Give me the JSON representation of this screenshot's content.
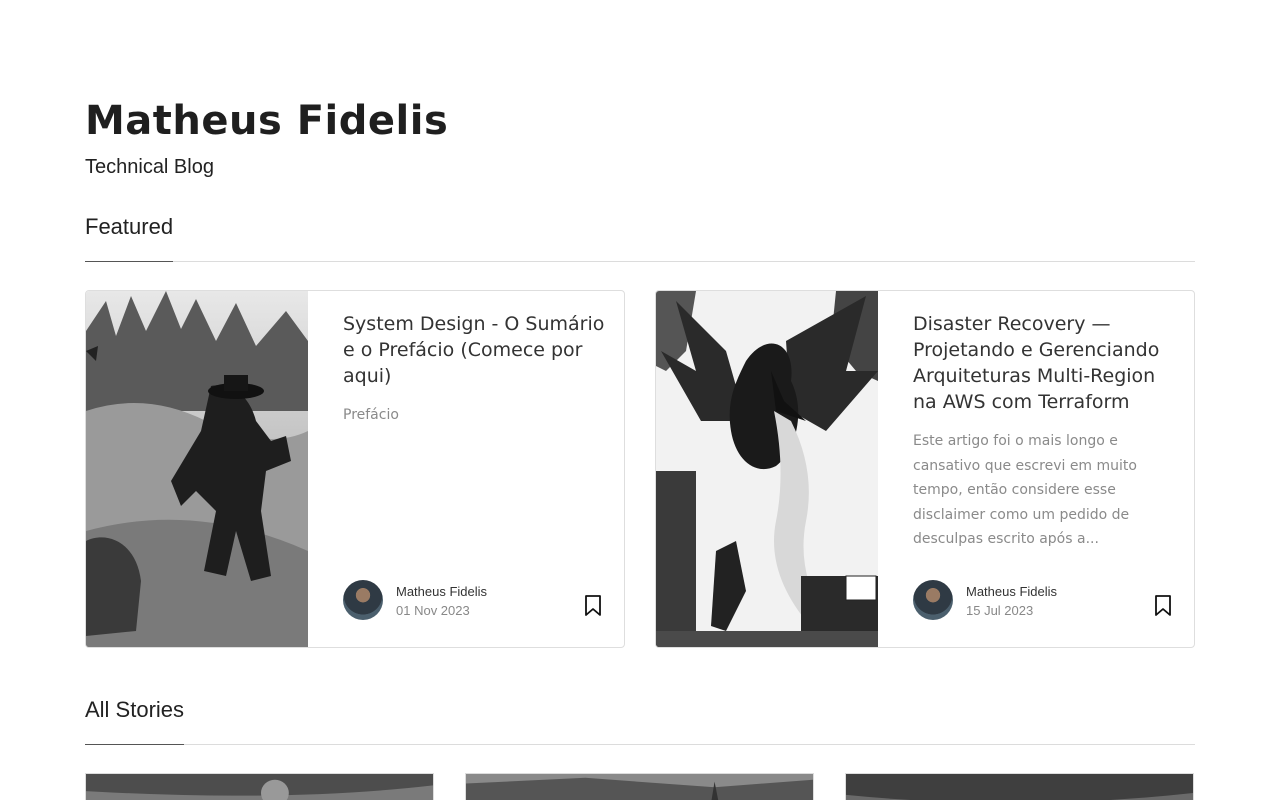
{
  "site": {
    "title": "Matheus Fidelis",
    "subtitle": "Technical Blog"
  },
  "sections": {
    "featured": "Featured",
    "all_stories": "All Stories"
  },
  "featured": [
    {
      "title": "System Design - O Sumário e o Prefácio (Comece por aqui)",
      "excerpt": "Prefácio",
      "author": "Matheus Fidelis",
      "date": "01 Nov 2023",
      "image_icon": "traveler-illustration"
    },
    {
      "title": "Disaster Recovery — Projetando e Gerenciando Arquiteturas Multi-Region na AWS com Terraform",
      "excerpt": "Este artigo foi o mais longo e cansativo que escrevi em muito tempo, então considere esse disclaimer como um pedido de desculpas escrito após a...",
      "author": "Matheus Fidelis",
      "date": "15 Jul 2023",
      "image_icon": "dragon-illustration"
    }
  ],
  "stories": [
    {
      "image_icon": "story-thumbnail-1"
    },
    {
      "image_icon": "story-thumbnail-2"
    },
    {
      "image_icon": "story-thumbnail-3"
    }
  ],
  "colors": {
    "text": "#222222",
    "muted": "#8a8a8a",
    "border": "#dedede",
    "background": "#ffffff"
  }
}
